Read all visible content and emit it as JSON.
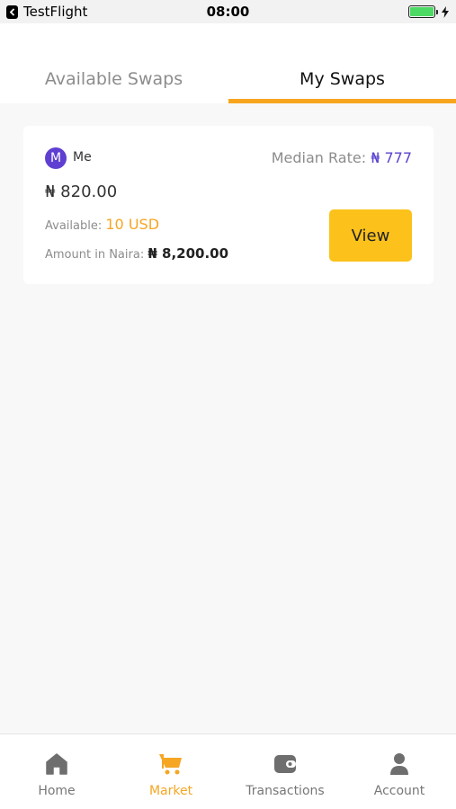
{
  "status_bar": {
    "app_name": "TestFlight",
    "time": "08:00"
  },
  "tabs": [
    {
      "label": "Available Swaps",
      "active": false
    },
    {
      "label": "My Swaps",
      "active": true
    }
  ],
  "swap": {
    "avatar_initial": "M",
    "owner": "Me",
    "median_rate_label": "Median Rate:",
    "median_rate_value": "₦ 777",
    "price": "₦ 820.00",
    "available_label": "Available:",
    "available_value": "10 USD",
    "naira_label": "Amount in Naira:",
    "naira_value": "₦ 8,200.00",
    "view_label": "View"
  },
  "nav": {
    "items": [
      {
        "label": "Home",
        "icon": "home-icon",
        "active": false
      },
      {
        "label": "Market",
        "icon": "cart-icon",
        "active": true
      },
      {
        "label": "Transactions",
        "icon": "wallet-icon",
        "active": false
      },
      {
        "label": "Account",
        "icon": "user-icon",
        "active": false
      }
    ]
  },
  "colors": {
    "accent": "#f7a51e",
    "button": "#fcc21b",
    "rate": "#5b44cf",
    "avatar": "#5f3fd1",
    "battery": "#4cd964"
  }
}
